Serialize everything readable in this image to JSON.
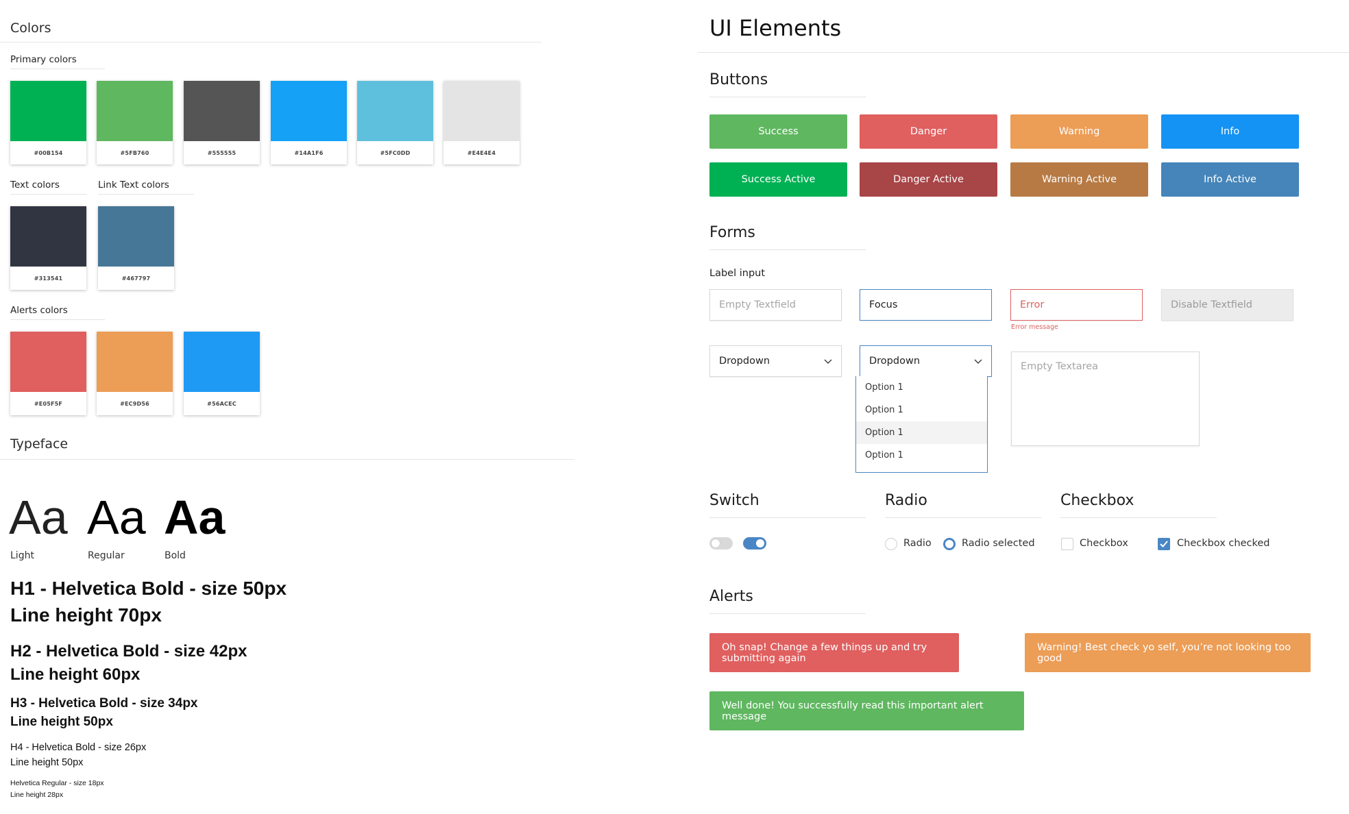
{
  "colors": {
    "title": "Colors",
    "primary_title": "Primary colors",
    "primary": [
      {
        "hex": "#00B154",
        "color": "#00B154"
      },
      {
        "hex": "#5FB760",
        "color": "#5FB760"
      },
      {
        "hex": "#555555",
        "color": "#555555"
      },
      {
        "hex": "#14A1F6",
        "color": "#14A1F6"
      },
      {
        "hex": "#5FC0DD",
        "color": "#5FC0DD"
      },
      {
        "hex": "#E4E4E4",
        "color": "#E4E4E4"
      }
    ],
    "text_title": "Text colors",
    "text": [
      {
        "hex": "#313541",
        "color": "#313541"
      }
    ],
    "link_title": "Link Text colors",
    "link": [
      {
        "hex": "#467797",
        "color": "#467797"
      }
    ],
    "alerts_title": "Alerts colors",
    "alerts": [
      {
        "hex": "#E05F5F",
        "color": "#E05F5F"
      },
      {
        "hex": "#EC9D56",
        "color": "#EC9D56"
      },
      {
        "hex": "#56ACEC",
        "color": "#1E9AF5"
      }
    ]
  },
  "typeface": {
    "title": "Typeface",
    "samples": [
      {
        "glyph": "Aa",
        "caption": "Light"
      },
      {
        "glyph": "Aa",
        "caption": "Regular"
      },
      {
        "glyph": "Aa",
        "caption": "Bold"
      }
    ],
    "h1": [
      "H1 - Helvetica Bold - size 50px",
      "Line height 70px"
    ],
    "h2": [
      "H2 - Helvetica Bold - size 42px",
      "Line height 60px"
    ],
    "h3": [
      "H3 - Helvetica Bold - size 34px",
      "Line height 50px"
    ],
    "h4": [
      "H4 - Helvetica Bold - size 26px",
      "Line height 50px"
    ],
    "body": [
      "Helvetica Regular - size 18px",
      "Line height 28px"
    ]
  },
  "ui": {
    "title": "UI Elements",
    "buttons_title": "Buttons",
    "buttons": [
      {
        "label": "Success",
        "color": "#5FB760"
      },
      {
        "label": "Danger",
        "color": "#E05F5F"
      },
      {
        "label": "Warning",
        "color": "#EC9D56"
      },
      {
        "label": "Info",
        "color": "#1493F5"
      },
      {
        "label": "Success Active",
        "color": "#00B154"
      },
      {
        "label": "Danger Active",
        "color": "#A84547"
      },
      {
        "label": "Warning Active",
        "color": "#B77A45"
      },
      {
        "label": "Info Active",
        "color": "#4585BA"
      }
    ],
    "forms_title": "Forms",
    "label_input": "Label input",
    "fields": {
      "empty": "Empty Textfield",
      "focus": "Focus",
      "error": "Error",
      "error_message": "Error message",
      "disabled": "Disable Textfield"
    },
    "dropdown_closed": "Dropdown",
    "dropdown_open": "Dropdown",
    "dropdown_options": [
      "Option 1",
      "Option 1",
      "Option 1",
      "Option 1"
    ],
    "textarea_placeholder": "Empty Textarea",
    "switch_title": "Switch",
    "radio_title": "Radio",
    "radio_label": "Radio",
    "radio_selected_label": "Radio selected",
    "checkbox_title": "Checkbox",
    "checkbox_label": "Checkbox",
    "checkbox_checked_label": "Checkbox checked",
    "alerts_title": "Alerts",
    "alerts": [
      {
        "text": "Oh snap! Change a few things up and try submitting again",
        "color": "#E05F5F"
      },
      {
        "text": "Warning! Best check yo self, you’re not looking too good",
        "color": "#EC9D56"
      },
      {
        "text": "Well done! You successfully read this important alert message",
        "color": "#5FB760"
      }
    ],
    "accent": "#4A86C5"
  }
}
